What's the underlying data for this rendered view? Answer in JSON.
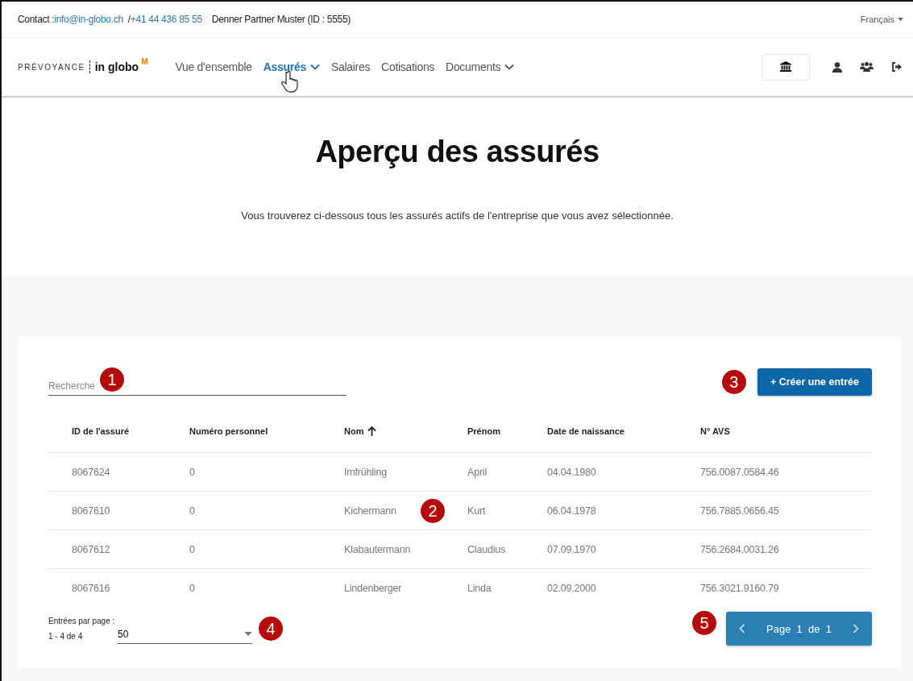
{
  "top_bar": {
    "contact_label": "Contact :",
    "email": "info@in-globo.ch",
    "separator": "/",
    "phone": "+41 44 436 85 55",
    "partner": "Denner Partner Muster (ID : 5555)",
    "language": "Français"
  },
  "header": {
    "logo_left": "PRÉVOYANCE",
    "logo_right": "in globo",
    "logo_mark": "M",
    "nav": [
      {
        "label": "Vue d'ensemble",
        "selected": false,
        "has_menu": false
      },
      {
        "label": "Assurés",
        "selected": true,
        "has_menu": true
      },
      {
        "label": "Salaires",
        "selected": false,
        "has_menu": false
      },
      {
        "label": "Cotisations",
        "selected": false,
        "has_menu": false
      },
      {
        "label": "Documents",
        "selected": false,
        "has_menu": true
      }
    ]
  },
  "hero": {
    "title": "Aperçu des assurés",
    "subtitle": "Vous trouverez ci-dessous tous les assurés actifs de l'entreprise que vous avez sélectionnée."
  },
  "search": {
    "placeholder": "Recherche"
  },
  "create_button": "+ Créer une entrée",
  "table": {
    "columns": [
      {
        "label": "ID de l'assuré",
        "sorted": false
      },
      {
        "label": "Numéro personnel",
        "sorted": false
      },
      {
        "label": "Nom",
        "sorted": true
      },
      {
        "label": "Prénom",
        "sorted": false
      },
      {
        "label": "Date de naissance",
        "sorted": false
      },
      {
        "label": "N° AVS",
        "sorted": false
      }
    ],
    "rows": [
      [
        "8067624",
        "0",
        "Imfrühling",
        "April",
        "04.04.1980",
        "756.0087.0584.46"
      ],
      [
        "8067610",
        "0",
        "Kichermann",
        "Kurt",
        "06.04.1978",
        "756.7885.0656.45"
      ],
      [
        "8067612",
        "0",
        "Klabautermann",
        "Claudius",
        "07.09.1970",
        "756.2684.0031.26"
      ],
      [
        "8067616",
        "0",
        "Lindenberger",
        "Linda",
        "02.09.2000",
        "756.3021.9160.79"
      ]
    ]
  },
  "footer": {
    "per_page_label": "Entrées par page :",
    "range": "1 - 4 de 4",
    "per_page_value": "50",
    "pager": "Page  1  de  1"
  },
  "callouts": [
    "1",
    "2",
    "3",
    "4",
    "5"
  ]
}
